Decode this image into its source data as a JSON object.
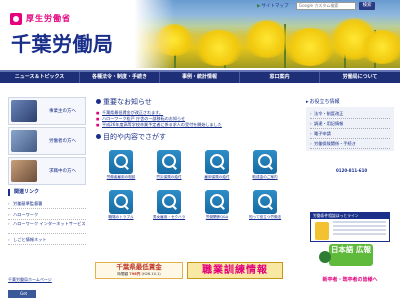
{
  "header": {
    "ministry": "厚生労働省",
    "title": "千葉労働局",
    "sitemap": "サイトマップ",
    "search_placeholder": "Google カスタム検索",
    "search_button": "検索"
  },
  "nav": [
    {
      "label": "ニュース＆トピックス"
    },
    {
      "label": "各種法令・制度・手続き"
    },
    {
      "label": "事例・統計情報"
    },
    {
      "label": "窓口案内"
    },
    {
      "label": "労働局について"
    }
  ],
  "audiences": [
    {
      "label": "事業主の方へ",
      "icon": "businessperson-photo"
    },
    {
      "label": "労働者の方へ",
      "icon": "worker-photo"
    },
    {
      "label": "求職中の方へ",
      "icon": "jobseeker-photo"
    }
  ],
  "left_links": {
    "title": "関連リンク",
    "items": [
      "労働基準監督署",
      "ハローワーク",
      "ハローワーク インターネットサービス",
      "しごと情報ネット"
    ],
    "twitter": "千葉労働局ホームページ",
    "facebook": "Get"
  },
  "notice": {
    "title": "重要なお知らせ",
    "items": [
      "千葉県最低賃金が改正されます。",
      "ハローワーク松戸 庁舎の一部移転のお知らせ",
      "平成26年度高等学校卒業予定者に係る求人の受付を開始しました"
    ]
  },
  "purpose": {
    "title": "目的や内容でさがす",
    "tiles": [
      "労働者雇用の相談",
      "労災保険の給付",
      "雇用保険の給付",
      "助成金のご案内",
      "職場のトラブル",
      "男女雇用・セクハラ",
      "労働関係Q&A",
      "知って役立つ労働法"
    ]
  },
  "banners": {
    "wage_title": "千葉県最低賃金",
    "wage_sub_prefix": "時間額",
    "wage_amount": "798円",
    "wage_date": "(H26.10.1)",
    "training": "職業訓練情報"
  },
  "right": {
    "title": "お役立ち情報",
    "links": [
      "法令・制度改正",
      "調達・用記情報",
      "電子申請",
      "労働保険関係・手続き"
    ],
    "phone": "0120-811-610",
    "wage_banner_title": "労働条件相談ほっとライン",
    "green_banner": "日本語 広報",
    "driver": "新卒者・既卒者の皆様へ"
  },
  "colors": {
    "brand_navy": "#1e2f78",
    "accent_magenta": "#e4007f",
    "tile_blue": "#2f8dc7"
  }
}
